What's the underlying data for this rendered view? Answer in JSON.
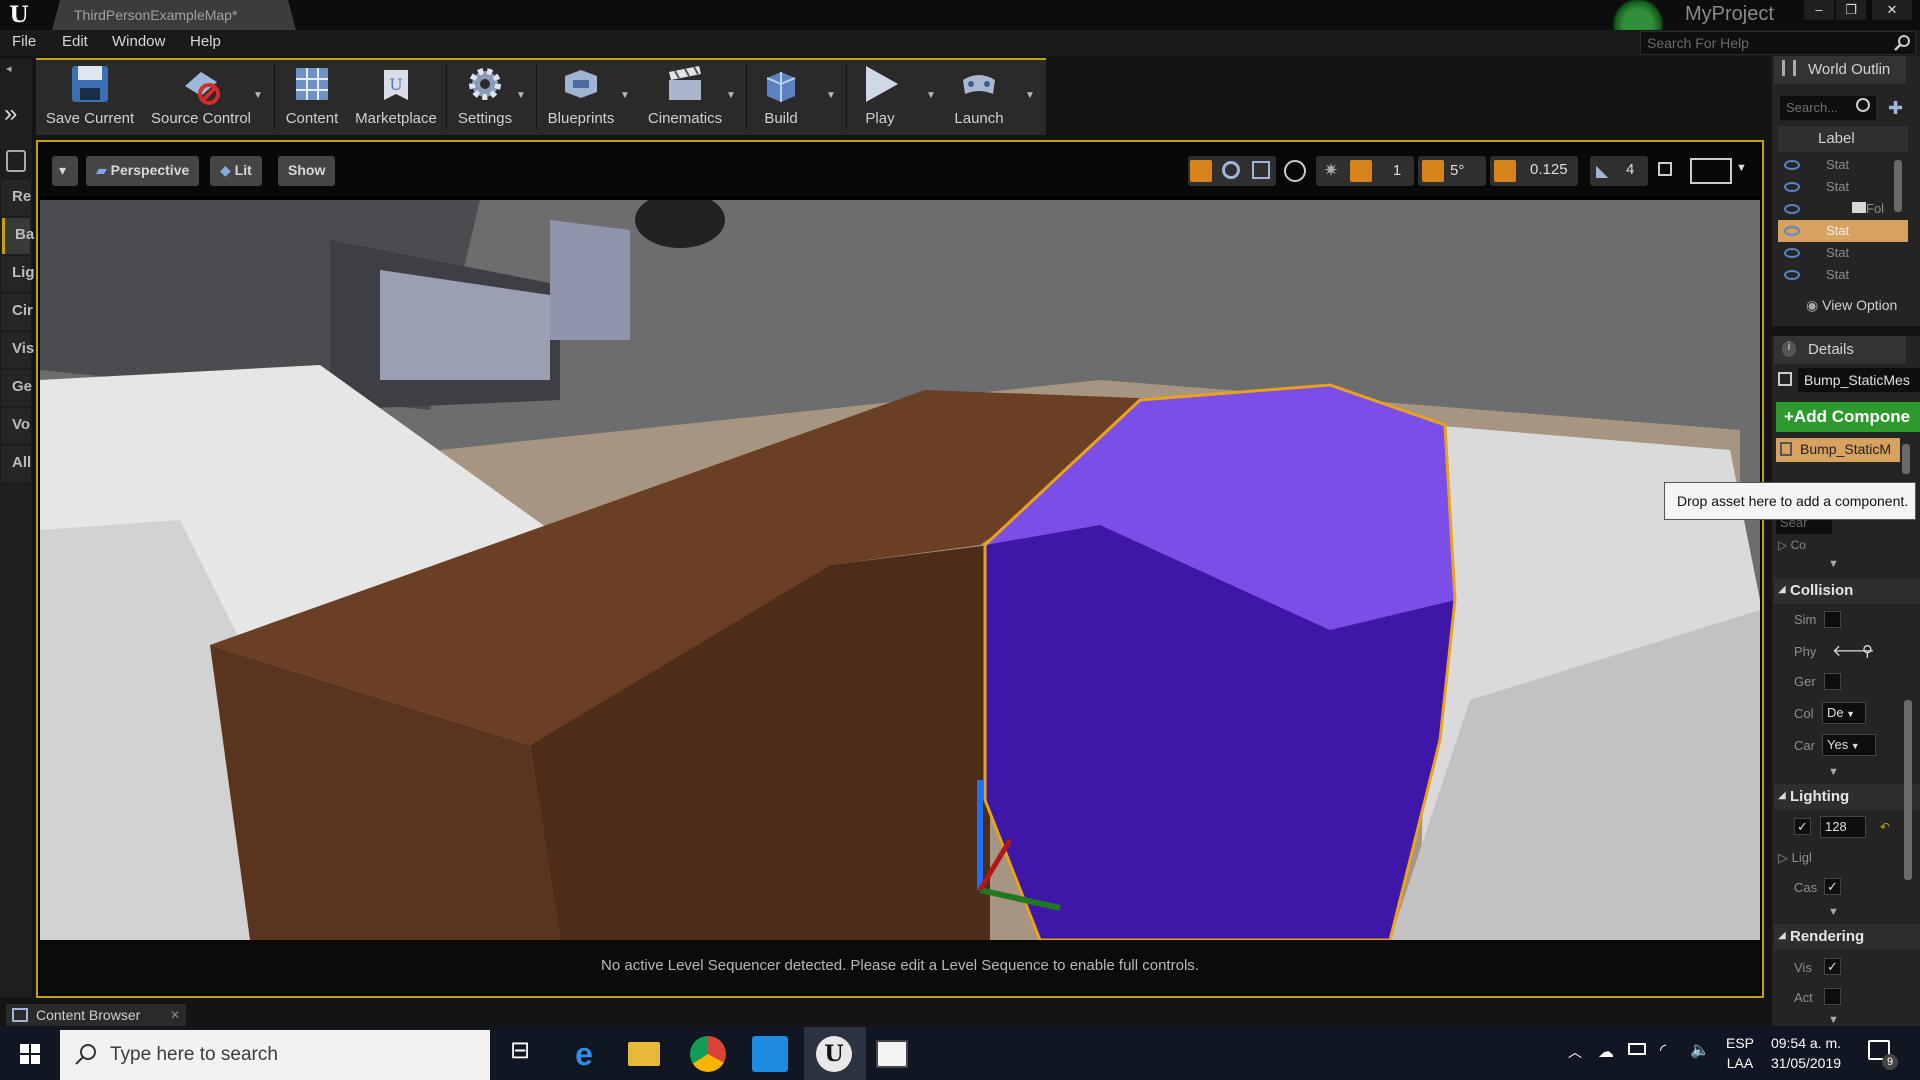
{
  "titlebar": {
    "doc_tab": "ThirdPersonExampleMap*",
    "project": "MyProject",
    "window_buttons": [
      "–",
      "❐",
      "✕"
    ]
  },
  "menubar": {
    "items": [
      "File",
      "Edit",
      "Window",
      "Help"
    ],
    "help_search_placeholder": "Search For Help"
  },
  "toolbar": {
    "buttons": [
      {
        "label": "Save Current",
        "icon": "save-icon"
      },
      {
        "label": "Source Control",
        "icon": "source-control-icon"
      },
      {
        "label": "Content",
        "icon": "content-icon"
      },
      {
        "label": "Marketplace",
        "icon": "marketplace-icon"
      },
      {
        "label": "Settings",
        "icon": "settings-icon"
      },
      {
        "label": "Blueprints",
        "icon": "blueprints-icon"
      },
      {
        "label": "Cinematics",
        "icon": "cinematics-icon"
      },
      {
        "label": "Build",
        "icon": "build-icon"
      },
      {
        "label": "Play",
        "icon": "play-icon"
      },
      {
        "label": "Launch",
        "icon": "launch-icon"
      }
    ]
  },
  "left_strip": {
    "tabs": [
      "Re",
      "Ba",
      "Lig",
      "Cir",
      "Vis",
      "Ge",
      "Vo",
      "All"
    ]
  },
  "viewport": {
    "view_mode": "Perspective",
    "lighting": "Lit",
    "show": "Show",
    "grid_snap": "1",
    "rotation_snap": "5°",
    "scale_snap": "0.125",
    "camera_speed": "4",
    "status_message": "No active Level Sequencer detected. Please edit a Level Sequence to enable full controls."
  },
  "outliner": {
    "title": "World Outlin",
    "search_placeholder": "Search...",
    "column": "Label",
    "rows": [
      "Stat",
      "Stat",
      "Fol",
      "Stat",
      "Stat",
      "Stat"
    ],
    "view_options": "View Option"
  },
  "details": {
    "title": "Details",
    "actor_name": "Bump_StaticMes",
    "add_component": "+Add Compone",
    "component": "Bump_StaticM",
    "tooltip": "Drop asset here to add a component.",
    "search_placeholder": "Sear",
    "collapsed_row": "Co",
    "sections": {
      "collision": {
        "title": "Collision",
        "props": [
          "Sim",
          "Phy",
          "Ger",
          "Col",
          "Car"
        ],
        "col_value": "De",
        "car_value": "Yes"
      },
      "lighting": {
        "title": "Lighting",
        "value": "128",
        "props": [
          "Ligl",
          "Cas"
        ]
      },
      "rendering": {
        "title": "Rendering",
        "props": [
          "Vis",
          "Act"
        ]
      }
    }
  },
  "content_browser": {
    "tab": "Content Browser"
  },
  "taskbar": {
    "search_placeholder": "Type here to search",
    "lang_top": "ESP",
    "lang_bottom": "LAA",
    "time": "09:54 a. m.",
    "date": "31/05/2019",
    "notification_count": "9"
  }
}
